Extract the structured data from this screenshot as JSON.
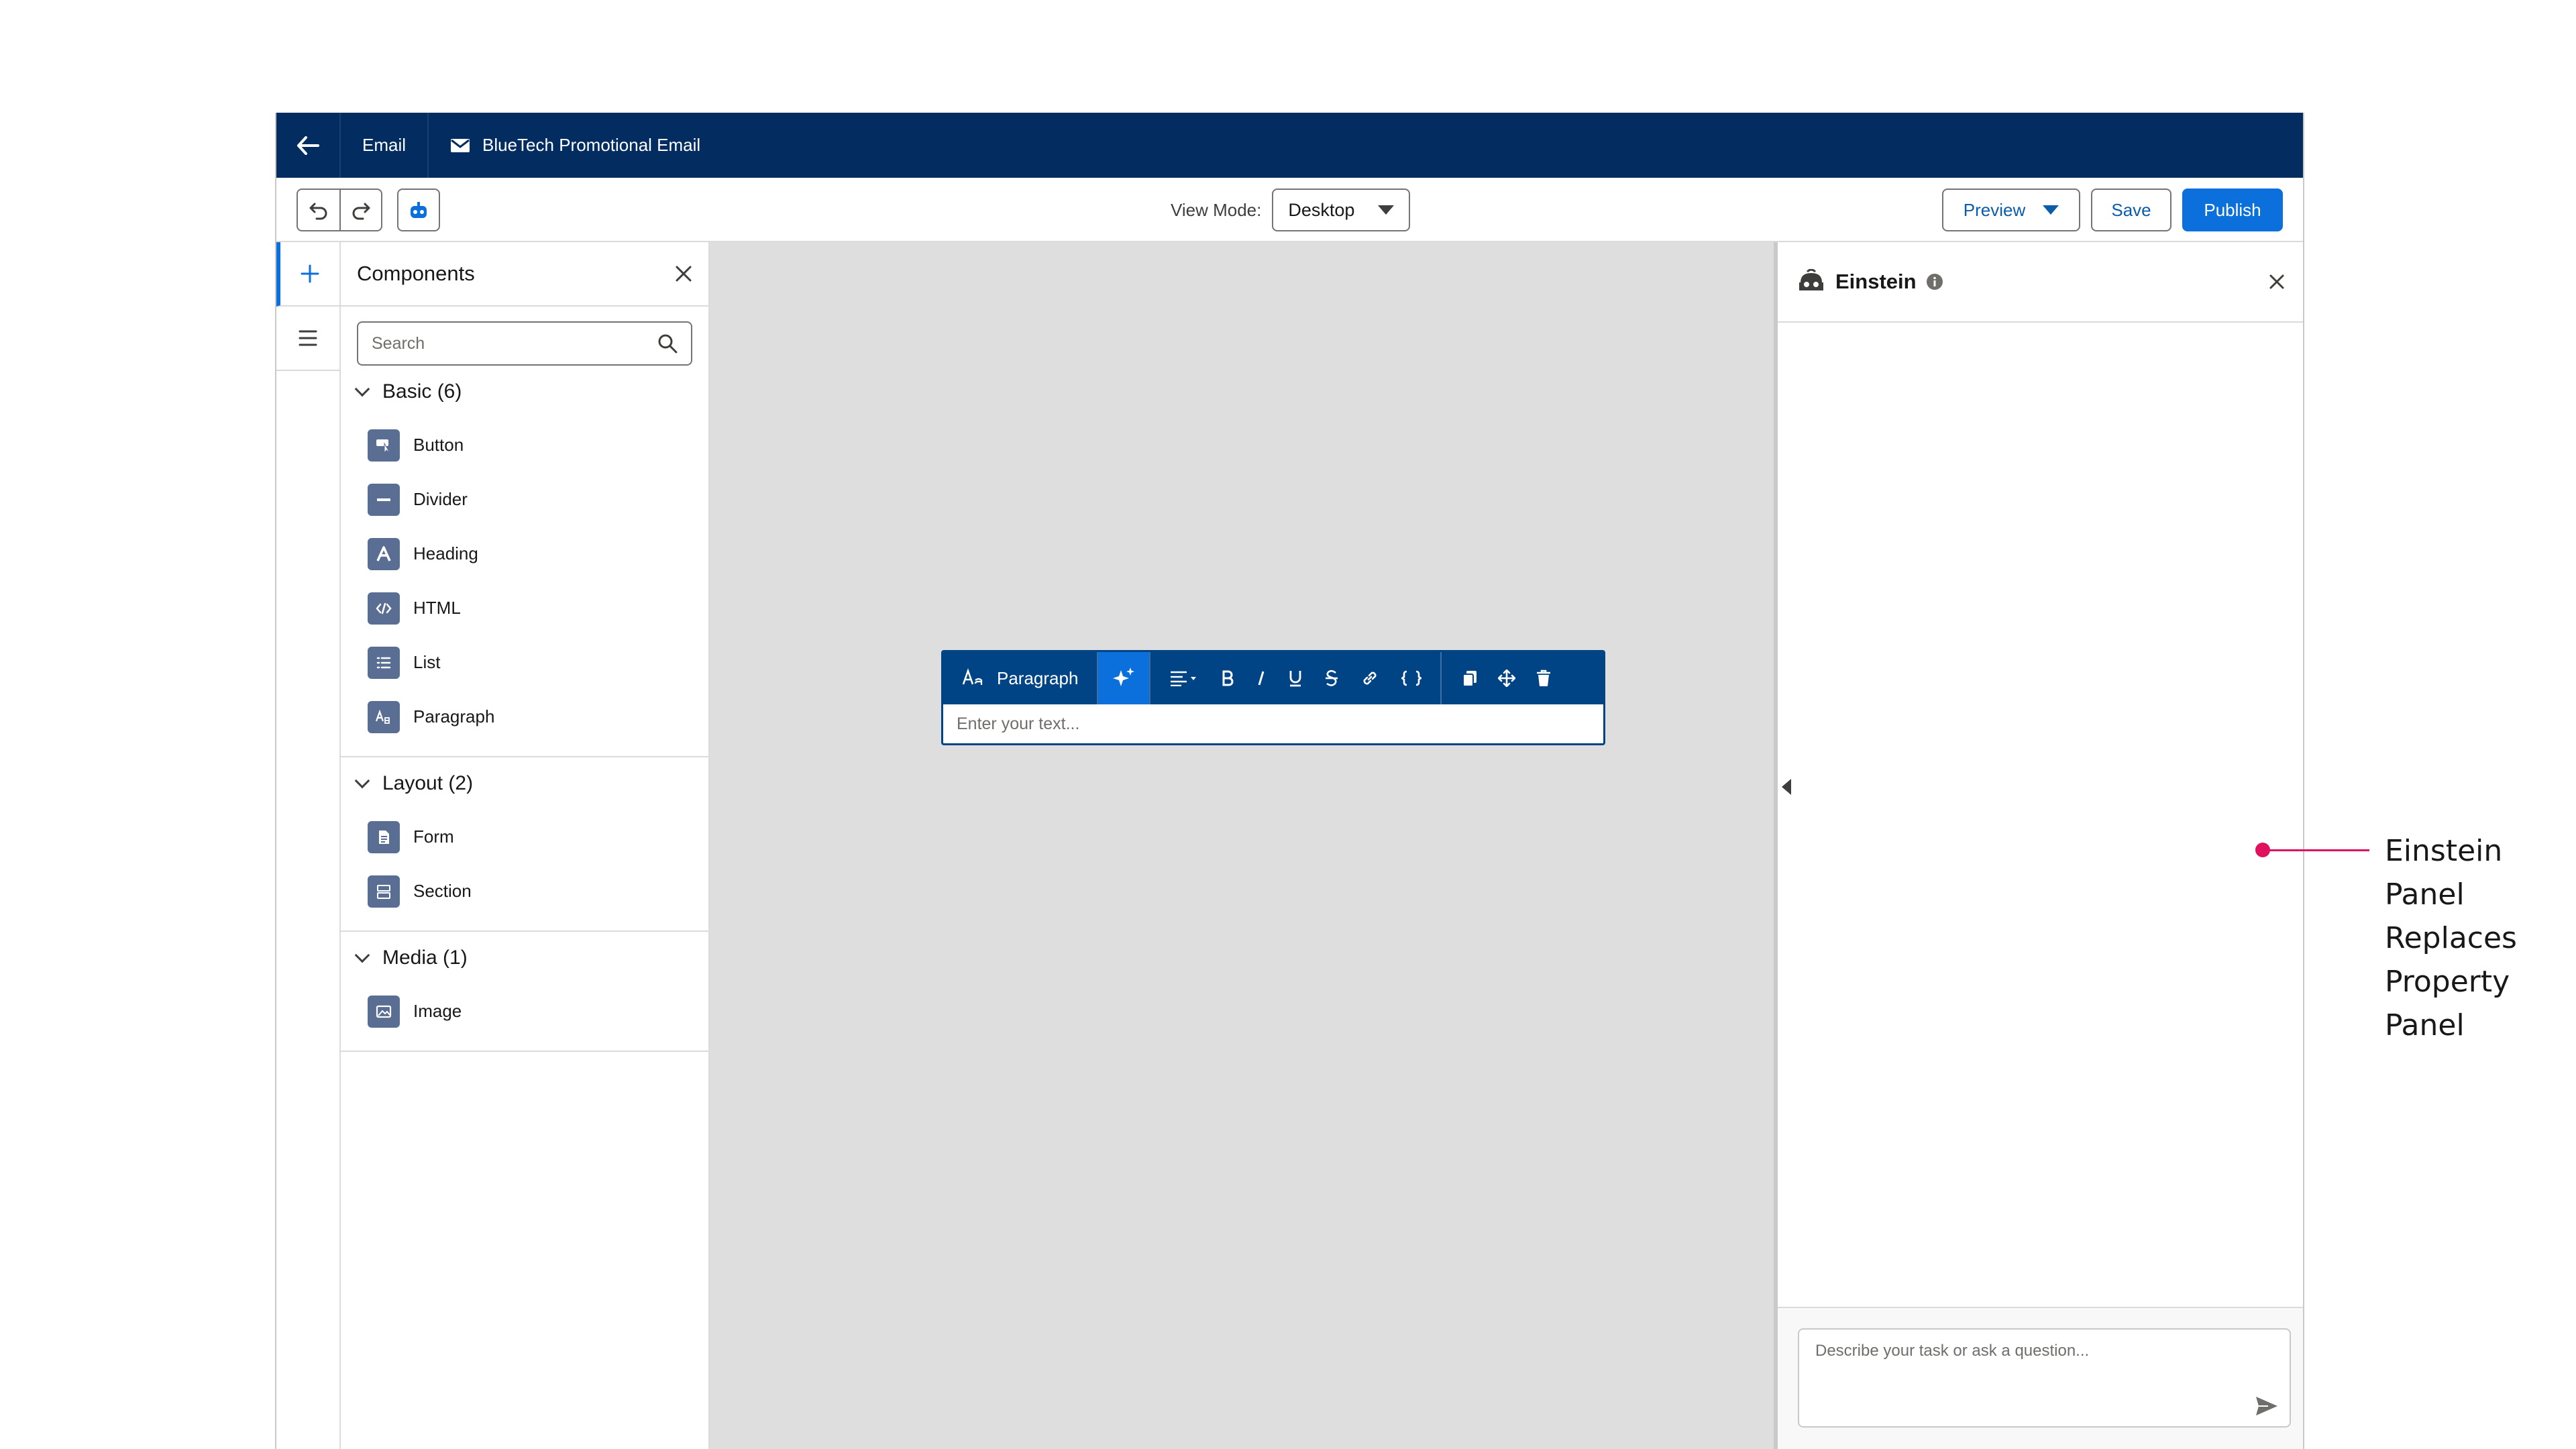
{
  "topbar": {
    "crumb": "Email",
    "tab_title": "BlueTech Promotional Email"
  },
  "toolbar": {
    "view_mode_label": "View Mode:",
    "view_mode_value": "Desktop",
    "preview_label": "Preview",
    "save_label": "Save",
    "publish_label": "Publish"
  },
  "components": {
    "title": "Components",
    "search_placeholder": "Search",
    "sections": [
      {
        "label": "Basic (6)",
        "items": [
          "Button",
          "Divider",
          "Heading",
          "HTML",
          "List",
          "Paragraph"
        ]
      },
      {
        "label": "Layout (2)",
        "items": [
          "Form",
          "Section"
        ]
      },
      {
        "label": "Media (1)",
        "items": [
          "Image"
        ]
      }
    ]
  },
  "editor": {
    "block_type": "Paragraph",
    "placeholder": "Enter your text..."
  },
  "einstein": {
    "title": "Einstein",
    "input_placeholder": "Describe your task or ask a question..."
  },
  "annotation": {
    "lines": [
      "Einstein",
      "Panel",
      "Replaces",
      "Property",
      "Panel"
    ],
    "color": "#e0115f"
  },
  "colors": {
    "brand_navy": "#032d60",
    "primary": "#0b6fdc",
    "editor_bar": "#014486"
  }
}
